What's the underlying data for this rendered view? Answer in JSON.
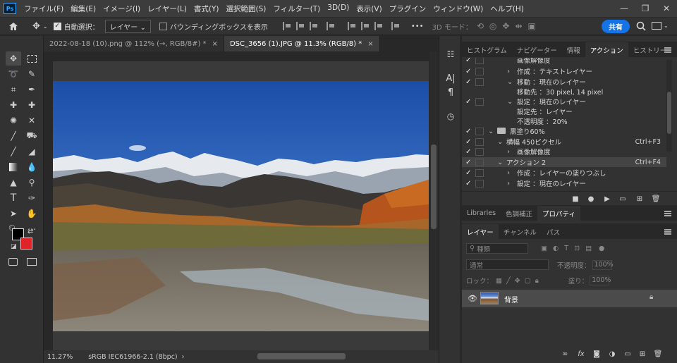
{
  "menubar": {
    "logo": "Ps",
    "items": [
      "ファイル(F)",
      "編集(E)",
      "イメージ(I)",
      "レイヤー(L)",
      "書式(Y)",
      "選択範囲(S)",
      "フィルター(T)",
      "3D(D)",
      "表示(V)",
      "プラグイン",
      "ウィンドウ(W)",
      "ヘルプ(H)"
    ],
    "window_controls": [
      "—",
      "❐",
      "✕"
    ]
  },
  "optbar": {
    "auto_select_label": "自動選択：",
    "auto_select_target": "レイヤー",
    "bounding_box_label": "バウンディングボックスを表示",
    "mode_3d_label": "3D モード：",
    "more_label": "•••",
    "share_label": "共有"
  },
  "tabs": [
    {
      "label": "2022-08-18 (10).png @ 112% (→, RGB/8#) *",
      "close": "×"
    },
    {
      "label": "DSC_3656 (1).JPG @ 11.3% (RGB/8) *",
      "close": "×"
    }
  ],
  "status": {
    "zoom": "11.27%",
    "profile": "sRGB IEC61966-2.1 (8bpc)",
    "arrow": "›"
  },
  "actions_panel": {
    "tabs": [
      "ヒストグラム",
      "ナビゲーター",
      "情報",
      "アクション",
      "ヒストリー"
    ],
    "active_tab": "アクション",
    "rows": [
      {
        "text": "画像解像度",
        "indent": 2,
        "arrow": "",
        "key": ""
      },
      {
        "text": "作成 ：テキストレイヤー",
        "indent": 2,
        "arrow": "›",
        "key": ""
      },
      {
        "text": "移動 ：現在のレイヤー",
        "indent": 2,
        "arrow": "⌄",
        "key": ""
      },
      {
        "text": "移動先 ：30 pixel, 14 pixel",
        "indent": 3,
        "arrow": "",
        "key": ""
      },
      {
        "text": "設定 ：現在のレイヤー",
        "indent": 2,
        "arrow": "⌄",
        "key": ""
      },
      {
        "text": "設定先 ：レイヤー",
        "indent": 3,
        "arrow": "",
        "key": ""
      },
      {
        "text": "不透明度 ：20%",
        "indent": 3,
        "arrow": "",
        "key": ""
      },
      {
        "text": "黒塗り60%",
        "indent": 0,
        "arrow": "⌄",
        "key": "",
        "folder": true
      },
      {
        "text": "横幅 450ピクセル",
        "indent": 1,
        "arrow": "⌄",
        "key": "Ctrl+F3"
      },
      {
        "text": "画像解像度",
        "indent": 2,
        "arrow": "›",
        "key": ""
      },
      {
        "text": "アクション 2",
        "indent": 1,
        "arrow": "⌄",
        "key": "Ctrl+F4",
        "highlight": true
      },
      {
        "text": "作成 ：レイヤーの塗りつぶし",
        "indent": 2,
        "arrow": "›",
        "key": ""
      },
      {
        "text": "設定 ：現在のレイヤー",
        "indent": 2,
        "arrow": "›",
        "key": ""
      }
    ]
  },
  "props_panel": {
    "tabs": [
      "Libraries",
      "色調補正",
      "プロパティ"
    ],
    "active_tab": "プロパティ"
  },
  "layers_panel": {
    "tabs": [
      "レイヤー",
      "チャンネル",
      "パス"
    ],
    "active_tab": "レイヤー",
    "filter_placeholder": "種類",
    "blend_mode": "通常",
    "opacity_label": "不透明度：",
    "opacity_value": "100%",
    "lock_label": "ロック：",
    "fill_label": "塗り：",
    "fill_value": "100%",
    "layer_name": "背景",
    "footer_icons": [
      "link-icon",
      "fx-icon",
      "mask-icon",
      "adjustment-icon",
      "group-icon",
      "new-layer-icon",
      "trash-icon"
    ]
  },
  "colors": {
    "accent": "#1473e6",
    "foreground": "#000000",
    "background": "#e0222a"
  }
}
